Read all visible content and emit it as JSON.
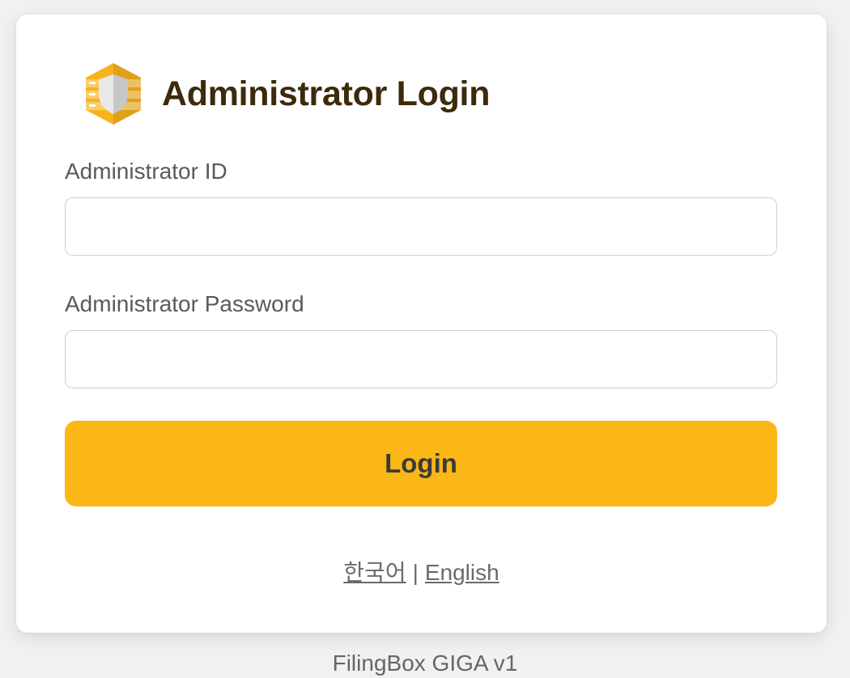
{
  "header": {
    "title": "Administrator Login",
    "logo_icon": "shield-server-icon"
  },
  "form": {
    "id_label": "Administrator ID",
    "id_value": "",
    "password_label": "Administrator Password",
    "password_value": "",
    "login_label": "Login"
  },
  "language": {
    "korean": "한국어",
    "separator": "|",
    "english": "English"
  },
  "footer": {
    "version": "FilingBox GIGA v1"
  },
  "colors": {
    "accent": "#fbb716",
    "title": "#3d2a0a",
    "background": "#f1f1f1"
  }
}
